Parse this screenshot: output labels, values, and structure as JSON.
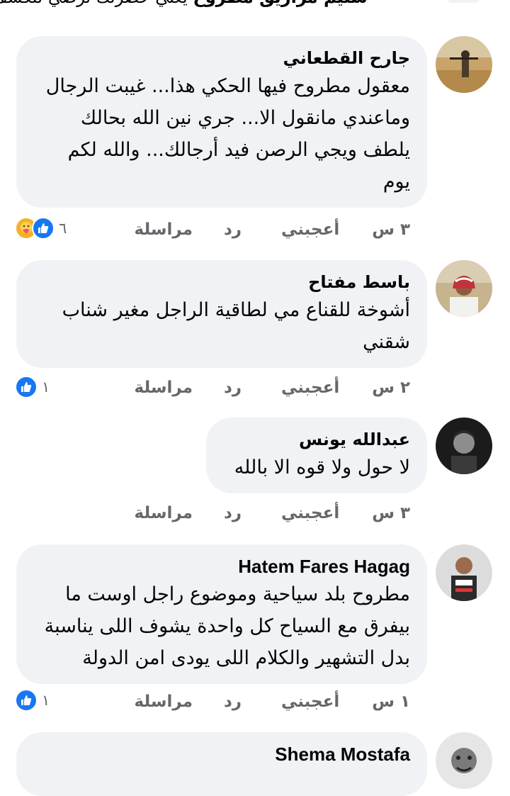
{
  "top_partial": {
    "name": "سليم مزاريق مطروح",
    "text": "يعني حضرتك ترضي لتكشف..."
  },
  "comments": [
    {
      "name": "جارح القطعاني",
      "lines": [
        "معقول مطروح فيها الحكي هذا... غيبت الرجال",
        "وماعندي مانقول الا... جري نين الله بحالك",
        "يلطف ويجي الرصن فيد أرجالك... والله لكم",
        "يوم"
      ],
      "time": "٣ س",
      "like": "أعجبني",
      "reply": "رد",
      "message": "مراسلة",
      "reaction_count": "٦"
    },
    {
      "name": "باسط مفتاح",
      "lines": [
        "أشوخة للقناع مي لطاقية الراجل مغير شناب",
        "شقني"
      ],
      "time": "٢ س",
      "like": "أعجبني",
      "reply": "رد",
      "message": "مراسلة",
      "reaction_count": "١"
    },
    {
      "name": "عبدالله يونس",
      "lines": [
        "لا حول ولا قوه الا بالله"
      ],
      "time": "٣ س",
      "like": "أعجبني",
      "reply": "رد",
      "message": "مراسلة"
    },
    {
      "name": "Hatem Fares Hagag",
      "lines": [
        "مطروح بلد سياحية وموضوع راجل اوست ما",
        "بيفرق مع السياح كل واحدة يشوف اللى يناسبة",
        "بدل التشهير والكلام اللى يودى امن الدولة"
      ],
      "time": "١ س",
      "like": "أعجبني",
      "reply": "رد",
      "message": "مراسلة",
      "reaction_count": "١"
    },
    {
      "name": "Shema Mostafa"
    }
  ],
  "colors": {
    "bubble": "#f0f2f5",
    "meta": "#65676b",
    "like_blue": "#1877f2",
    "care_yellow": "#f7b125"
  },
  "icons": [
    "like-reaction-icon",
    "care-reaction-icon"
  ]
}
